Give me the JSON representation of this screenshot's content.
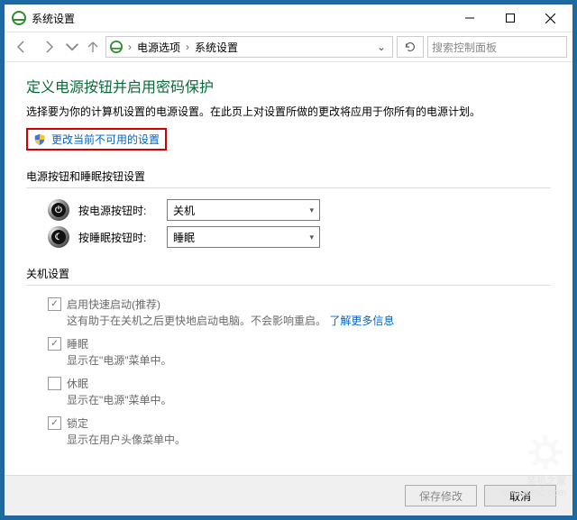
{
  "window": {
    "title": "系统设置"
  },
  "breadcrumb": {
    "a": "电源选项",
    "b": "系统设置"
  },
  "search": {
    "placeholder": "搜索控制面板"
  },
  "h1": "定义电源按钮并启用密码保护",
  "desc": "选择要为你的计算机设置的电源设置。在此页上对设置所做的更改将应用于你所有的电源计划。",
  "shield_link": "更改当前不可用的设置",
  "section_buttons": "电源按钮和睡眠按钮设置",
  "row_power": {
    "label": "按电源按钮时:",
    "value": "关机"
  },
  "row_sleep": {
    "label": "按睡眠按钮时:",
    "value": "睡眠"
  },
  "section_shutdown": "关机设置",
  "opts": {
    "fastboot": {
      "title": "启用快速启动(推荐)",
      "sub1": "这有助于在关机之后更快地启动电脑。不会影响重启。",
      "link": "了解更多信息"
    },
    "sleep": {
      "title": "睡眠",
      "sub": "显示在\"电源\"菜单中。"
    },
    "hiber": {
      "title": "休眠",
      "sub": "显示在\"电源\"菜单中。"
    },
    "lock": {
      "title": "锁定",
      "sub": "显示在用户头像菜单中。"
    }
  },
  "footer": {
    "save": "保存修改",
    "cancel": "取消"
  },
  "watermark": {
    "a": "装机之家",
    "b": "www.lotpc.com"
  }
}
